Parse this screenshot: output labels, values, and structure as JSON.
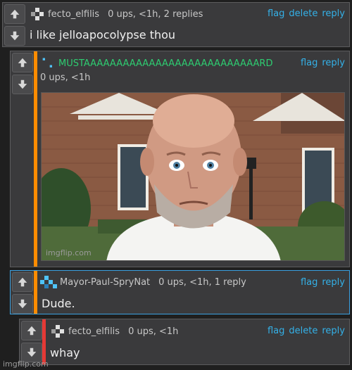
{
  "comments": [
    {
      "username": "fecto_elfilis",
      "meta": "0 ups, <1h, 2 replies",
      "actions": [
        "flag",
        "delete",
        "reply"
      ],
      "body": "i like jelloapocolypse thou"
    },
    {
      "username": "MUSTAAAAAAAAAAAAAAAAAAAAAAAAAAARD",
      "meta": "0 ups, <1h",
      "actions": [
        "flag",
        "reply"
      ],
      "body": "",
      "image": "bald bearded man with wide eyes in front of brick house"
    },
    {
      "username": "Mayor-Paul-SpryNat",
      "meta": "0 ups, <1h, 1 reply",
      "actions": [
        "flag",
        "reply"
      ],
      "body": "Dude."
    },
    {
      "username": "fecto_elfilis",
      "meta": "0 ups, <1h",
      "actions": [
        "flag",
        "delete",
        "reply"
      ],
      "body": "whay"
    }
  ],
  "icons": {
    "upvote": "arrow-up-icon",
    "downvote": "arrow-down-icon"
  },
  "colors": {
    "link": "#34b1e8",
    "accent_orange": "#ff8c00",
    "accent_blue": "#3aa0e0",
    "accent_red": "#e53935",
    "username_green": "#2ecc71",
    "avatar_cyan": "#4fc3f7"
  },
  "watermark": "imgflip.com"
}
